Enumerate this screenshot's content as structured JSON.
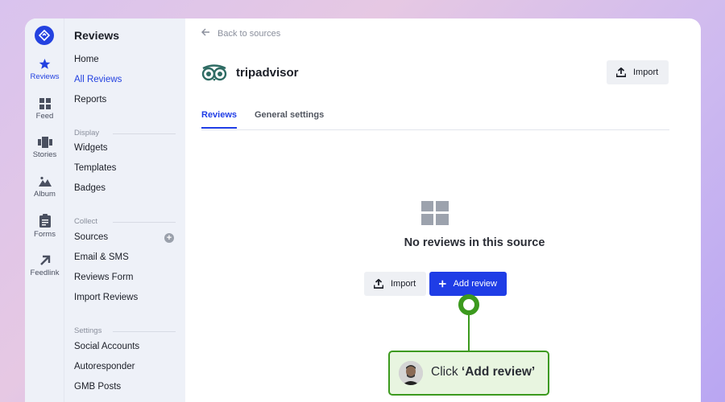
{
  "rail": {
    "items": [
      {
        "label": "Reviews",
        "icon": "star-icon",
        "active": true
      },
      {
        "label": "Feed",
        "icon": "grid-icon"
      },
      {
        "label": "Stories",
        "icon": "stories-icon"
      },
      {
        "label": "Album",
        "icon": "image-icon"
      },
      {
        "label": "Forms",
        "icon": "clipboard-icon"
      },
      {
        "label": "Feedlink",
        "icon": "arrow-up-right-icon"
      }
    ]
  },
  "nav": {
    "title": "Reviews",
    "items": [
      {
        "label": "Home"
      },
      {
        "label": "All Reviews",
        "active": true
      },
      {
        "label": "Reports"
      }
    ],
    "sections": [
      {
        "title": "Display",
        "items": [
          "Widgets",
          "Templates",
          "Badges"
        ]
      },
      {
        "title": "Collect",
        "items": [
          "Sources",
          "Email & SMS",
          "Reviews Form",
          "Import Reviews"
        ]
      },
      {
        "title": "Settings",
        "items": [
          "Social Accounts",
          "Autoresponder",
          "GMB Posts"
        ]
      }
    ]
  },
  "main": {
    "back_label": "Back to sources",
    "source_name": "tripadvisor",
    "import_label": "Import",
    "tabs": [
      {
        "label": "Reviews",
        "active": true
      },
      {
        "label": "General settings"
      }
    ],
    "empty_message": "No reviews in this source",
    "empty_import_label": "Import",
    "add_review_label": "Add review"
  },
  "callout": {
    "prefix": "Click",
    "action": "‘Add review’"
  },
  "colors": {
    "accent": "#1f3de6",
    "callout_green": "#3c9a1e",
    "rail_bg": "#eef1f8"
  }
}
